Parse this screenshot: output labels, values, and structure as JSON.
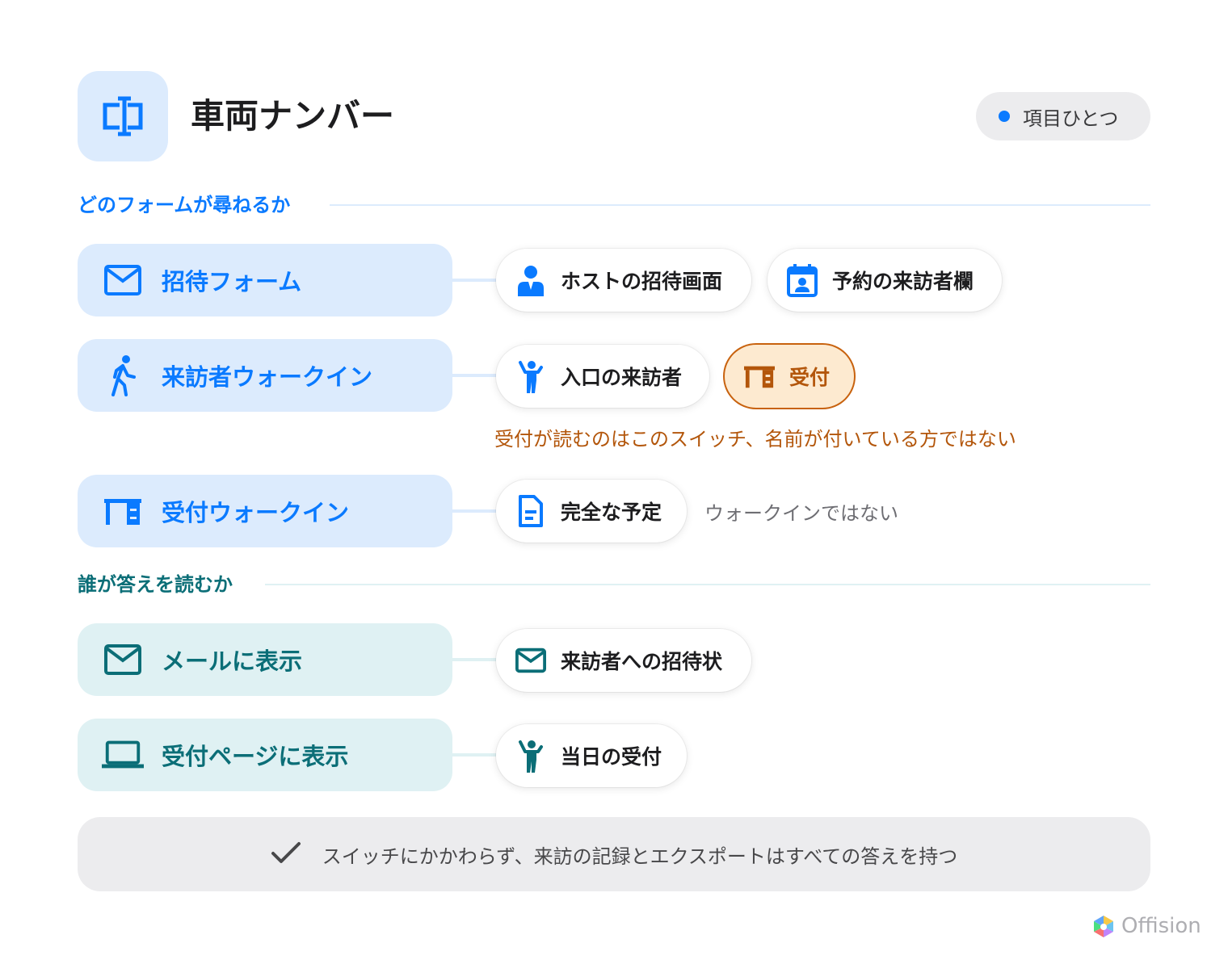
{
  "header": {
    "title": "車両ナンバー",
    "badge": "項目ひとつ",
    "icon": "text-field-icon"
  },
  "sections": {
    "forms": {
      "title": "どのフォームが尋ねるか"
    },
    "readers": {
      "title": "誰が答えを読むか"
    }
  },
  "rows": {
    "invite": {
      "label": "招待フォーム",
      "icon": "mail-icon",
      "pills": [
        {
          "label": "ホストの招待画面",
          "icon": "host-icon"
        },
        {
          "label": "予約の来訪者欄",
          "icon": "calendar-person-icon"
        }
      ]
    },
    "visitor_walkin": {
      "label": "来訪者ウォークイン",
      "icon": "walking-person-icon",
      "pills": [
        {
          "label": "入口の来訪者",
          "icon": "waving-person-icon"
        },
        {
          "label": "受付",
          "icon": "reception-desk-icon",
          "highlight": "#c8620e"
        }
      ],
      "note": "受付が読むのはこのスイッチ、名前が付いている方ではない"
    },
    "reception_walkin": {
      "label": "受付ウォークイン",
      "icon": "reception-desk-icon",
      "pills": [
        {
          "label": "完全な予定",
          "icon": "document-icon"
        }
      ],
      "note": "ウォークインではない"
    },
    "email": {
      "label": "メールに表示",
      "icon": "mail-icon",
      "pills": [
        {
          "label": "来訪者への招待状",
          "icon": "mail-icon"
        }
      ]
    },
    "reception_page": {
      "label": "受付ページに表示",
      "icon": "laptop-icon",
      "pills": [
        {
          "label": "当日の受付",
          "icon": "waving-person-icon"
        }
      ]
    }
  },
  "footer": {
    "text": "スイッチにかかわらず、来訪の記録とエクスポートはすべての答えを持つ",
    "icon": "check-icon"
  },
  "brand": {
    "name": "Offision"
  },
  "colors": {
    "blue": "#0a7aff",
    "teal": "#0b6e77",
    "orange": "#c8620e",
    "blue_bg": "#dcebfd",
    "teal_bg": "#dff1f3"
  }
}
